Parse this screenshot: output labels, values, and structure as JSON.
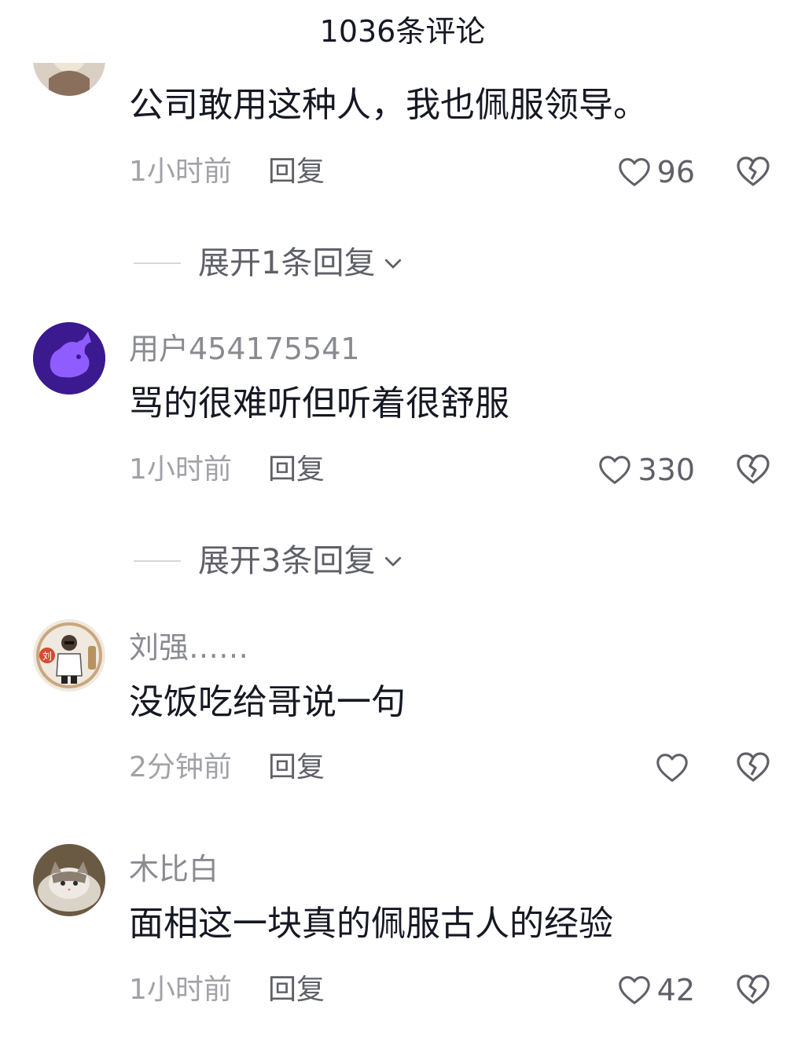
{
  "header": {
    "title": "1036条评论"
  },
  "comments": [
    {
      "username": "",
      "text": "公司敢用这种人，我也佩服领导。",
      "time": "1小时前",
      "reply_label": "回复",
      "likes": "96",
      "expand_label": "展开1条回复"
    },
    {
      "username": "用户454175541",
      "text": "骂的很难听但听着很舒服",
      "time": "1小时前",
      "reply_label": "回复",
      "likes": "330",
      "expand_label": "展开3条回复"
    },
    {
      "username": "刘强……",
      "text": "没饭吃给哥说一句",
      "time": "2分钟前",
      "reply_label": "回复",
      "likes": ""
    },
    {
      "username": "木比白",
      "text": "面相这一块真的佩服古人的经验",
      "time": "1小时前",
      "reply_label": "回复",
      "likes": "42"
    }
  ],
  "avatar_badges": {
    "liu": "刘"
  },
  "colors": {
    "text_primary": "#161823",
    "text_secondary": "#8a8b91",
    "text_meta": "#a1a2a8",
    "icon": "#5f6068",
    "avatar_purple": "#5a19d6"
  },
  "icons": {
    "like": "heart-outline-icon",
    "dislike": "broken-heart-icon",
    "expand": "chevron-down-icon"
  }
}
